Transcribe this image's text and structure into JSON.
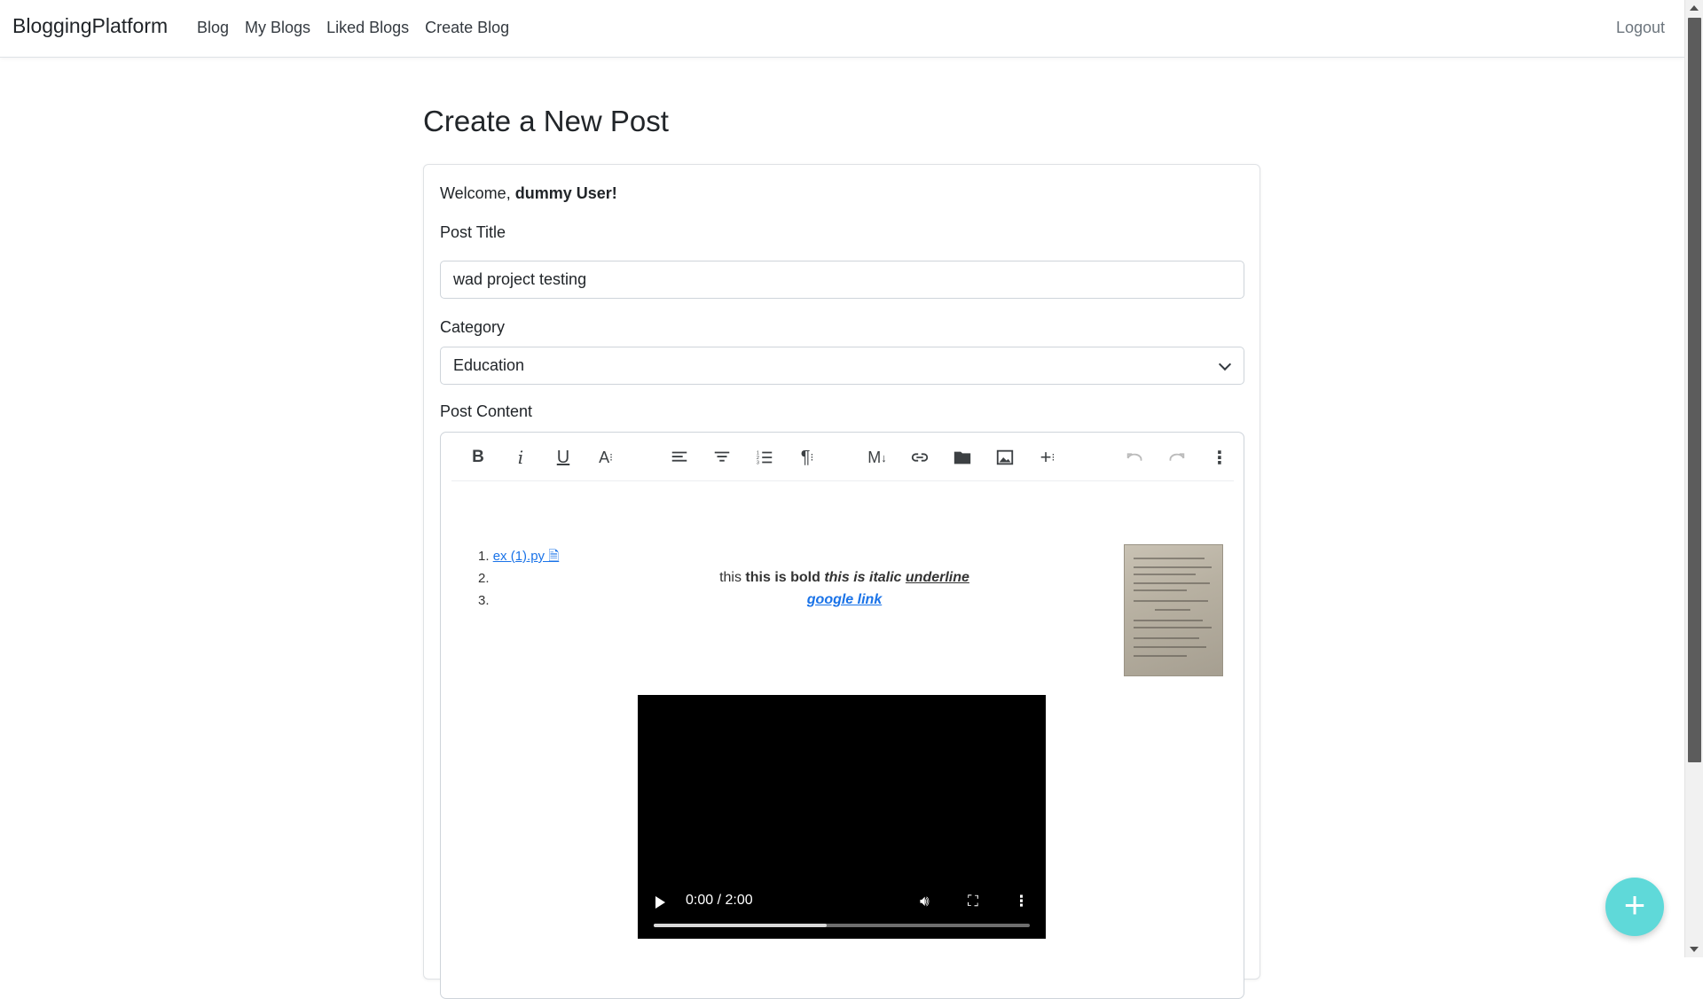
{
  "nav": {
    "brand": "BloggingPlatform",
    "links": [
      "Blog",
      "My Blogs",
      "Liked Blogs",
      "Create Blog"
    ],
    "logout": "Logout"
  },
  "page": {
    "title": "Create a New Post"
  },
  "form": {
    "welcome_prefix": "Welcome, ",
    "welcome_user": "dummy User!",
    "title_label": "Post Title",
    "title_value": "wad project testing",
    "category_label": "Category",
    "category_value": "Education",
    "content_label": "Post Content"
  },
  "editor": {
    "toolbar_icons": [
      "bold-icon",
      "italic-icon",
      "underline-icon",
      "font-size-icon",
      "align-left-icon",
      "align-center-icon",
      "ordered-list-icon",
      "paragraph-icon",
      "markdown-icon",
      "link-icon",
      "folder-icon",
      "image-icon",
      "insert-icon",
      "undo-icon",
      "redo-icon",
      "more-icon"
    ],
    "list": {
      "n1": "1.",
      "n2": "2.",
      "n3": "3.",
      "item1_link": "ex (1).py 🗎"
    },
    "line1": {
      "plain": "this ",
      "bold": "this is bold ",
      "italic": "this is italic ",
      "underline": "underline"
    },
    "line2_link": "google link",
    "video": {
      "time": "0:00 / 2:00",
      "progress": 0.46
    }
  },
  "colors": {
    "accent": "#5fd9d9",
    "link": "#1a73e8"
  }
}
